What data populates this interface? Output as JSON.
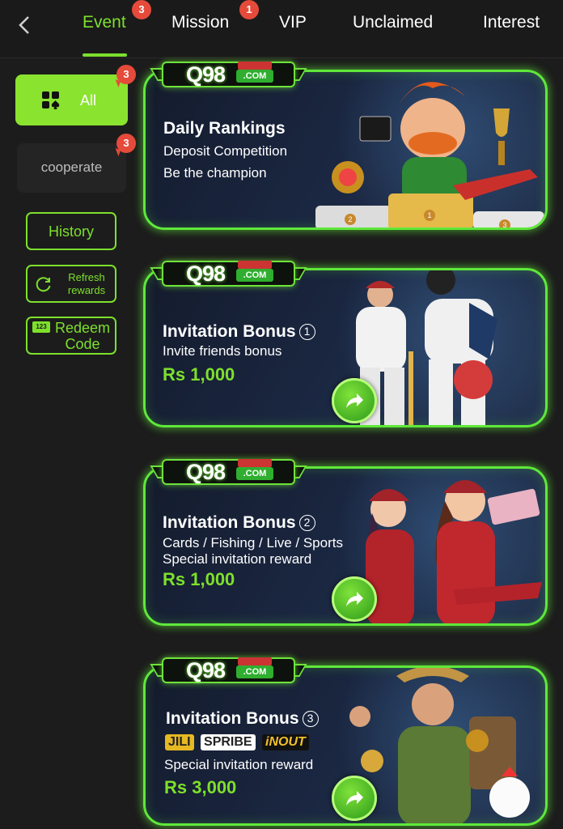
{
  "header": {
    "back_icon": "chevron-left-icon",
    "tabs": [
      {
        "label": "Event",
        "active": true,
        "badge": "3"
      },
      {
        "label": "Mission",
        "active": false,
        "badge": "1"
      },
      {
        "label": "VIP",
        "active": false
      },
      {
        "label": "Unclaimed",
        "active": false
      },
      {
        "label": "Interest",
        "active": false
      }
    ]
  },
  "sidebar": {
    "categories": [
      {
        "label": "All",
        "badge": "3",
        "selected": true,
        "icon": "grid-spade-icon"
      },
      {
        "label": "cooperate",
        "badge": "3",
        "selected": false
      }
    ],
    "history_label": "History",
    "refresh_label": "Refresh rewards",
    "redeem_label": "Redeem Code",
    "redeem_icon_text": "123"
  },
  "banners": [
    {
      "logo": "Q98",
      "logo_domain": ".COM",
      "title": "Daily Rankings",
      "lines": [
        "Deposit Competition",
        "Be the champion"
      ],
      "podium": [
        "2",
        "1",
        "3"
      ]
    },
    {
      "logo": "Q98",
      "logo_domain": ".COM",
      "title": "Invitation Bonus",
      "number": "1",
      "lines": [
        "Invite friends bonus"
      ],
      "amount": "Rs 1,000"
    },
    {
      "logo": "Q98",
      "logo_domain": ".COM",
      "title": "Invitation Bonus",
      "number": "2",
      "lines": [
        "Cards / Fishing / Live / Sports",
        "Special invitation reward"
      ],
      "amount": "Rs 1,000"
    },
    {
      "logo": "Q98",
      "logo_domain": ".COM",
      "title": "Invitation Bonus",
      "number": "3",
      "brands": [
        "JILI",
        "SPRIBE",
        "iNOUT"
      ],
      "lines": [
        "Special invitation reward"
      ],
      "amount": "Rs 3,000"
    }
  ],
  "colors": {
    "accent": "#7de02c",
    "badge": "#e54a3a",
    "background": "#1c1c1c"
  }
}
